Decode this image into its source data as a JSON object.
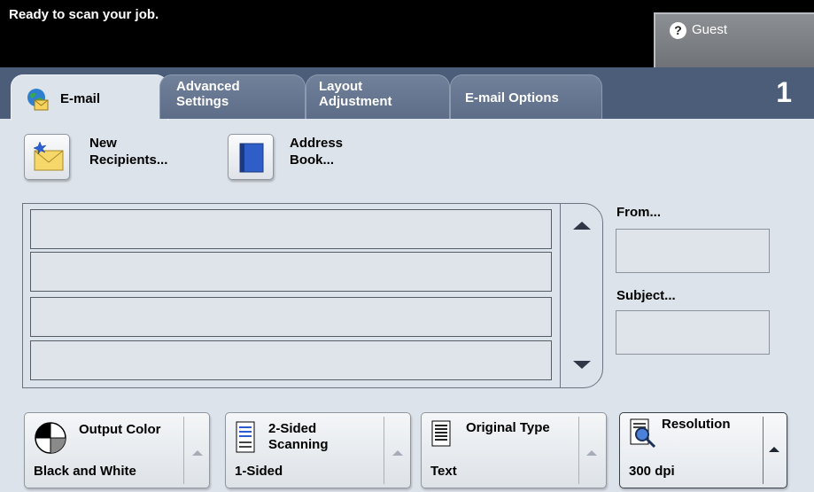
{
  "status": {
    "message": "Ready to scan your job."
  },
  "user": {
    "label": "Guest",
    "icon": "help-icon"
  },
  "tabs": [
    {
      "line1": "E-mail",
      "line2": "",
      "active": true
    },
    {
      "line1": "Advanced",
      "line2": "Settings",
      "active": false
    },
    {
      "line1": "Layout",
      "line2": "Adjustment",
      "active": false
    },
    {
      "line1": "E-mail Options",
      "line2": "",
      "active": false
    }
  ],
  "job_count": "1",
  "actions": {
    "new_recipients": {
      "line1": "New",
      "line2": "Recipients..."
    },
    "address_book": {
      "line1": "Address",
      "line2": "Book..."
    }
  },
  "recipients": [
    "",
    "",
    "",
    ""
  ],
  "fields": {
    "from_label": "From...",
    "from_value": "",
    "subject_label": "Subject...",
    "subject_value": ""
  },
  "features": {
    "output_color": {
      "title": "Output Color",
      "value": "Black and White"
    },
    "two_sided": {
      "title_line1": "2-Sided",
      "title_line2": "Scanning",
      "value": "1-Sided"
    },
    "original_type": {
      "title": "Original Type",
      "value": "Text"
    },
    "resolution": {
      "title": "Resolution",
      "value": "300 dpi"
    }
  },
  "colors": {
    "status_bar": "#000000",
    "tab_strip": "#4c5d7a",
    "panel": "#dde3ea"
  }
}
